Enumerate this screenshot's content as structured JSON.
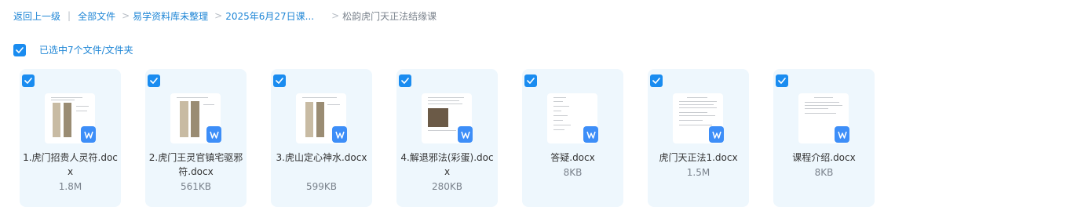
{
  "breadcrumb": {
    "back": "返回上一级",
    "divider": "|",
    "items": [
      "全部文件",
      "易学资料库未整理",
      "2025年6月27日课..."
    ],
    "arrow": ">",
    "current": "松韵虎门天正法结缘课"
  },
  "selection": {
    "label": "已选中7个文件/文件夹",
    "checked": true
  },
  "files": [
    {
      "name": "1.虎门招贵人灵符.docx",
      "size": "1.8M",
      "checked": true,
      "icon": "word-doc-icon"
    },
    {
      "name": "2.虎门王灵官镇宅驱邪符.docx",
      "size": "561KB",
      "checked": true,
      "icon": "word-doc-icon"
    },
    {
      "name": "3.虎山定心神水.docx",
      "size": "599KB",
      "checked": true,
      "icon": "word-doc-icon"
    },
    {
      "name": "4.解退邪法(彩蛋).docx",
      "size": "280KB",
      "checked": true,
      "icon": "word-doc-icon"
    },
    {
      "name": "答疑.docx",
      "size": "8KB",
      "checked": true,
      "icon": "word-doc-icon"
    },
    {
      "name": "虎门天正法1.docx",
      "size": "1.5M",
      "checked": true,
      "icon": "word-doc-icon"
    },
    {
      "name": "课程介绍.docx",
      "size": "8KB",
      "checked": true,
      "icon": "word-doc-icon"
    }
  ],
  "colors": {
    "accent": "#1a8cf0",
    "link": "#1f86d6",
    "card_bg": "#eef7fd",
    "word_badge": "#3d8ef8"
  }
}
